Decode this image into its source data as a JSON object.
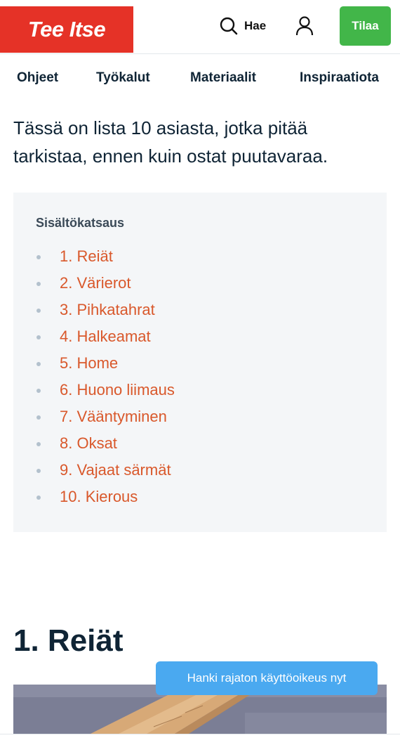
{
  "header": {
    "logo_text": "Tee Itse",
    "search_label": "Hae",
    "subscribe_label": "Tilaa"
  },
  "nav": {
    "items": [
      {
        "label": "Ohjeet"
      },
      {
        "label": "Työkalut"
      },
      {
        "label": "Materiaalit"
      },
      {
        "label": "Inspiraatiota"
      }
    ]
  },
  "article": {
    "intro": "Tässä on lista 10 asiasta, jotka pitää tarkistaa, ennen kuin ostat puutavaraa.",
    "toc": {
      "title": "Sisältökatsaus",
      "items": [
        {
          "label": "1. Reiät"
        },
        {
          "label": "2. Värierot"
        },
        {
          "label": "3. Pihkatahrat"
        },
        {
          "label": "4. Halkeamat"
        },
        {
          "label": "5. Home"
        },
        {
          "label": "6. Huono liimaus"
        },
        {
          "label": "7. Vääntyminen"
        },
        {
          "label": "8. Oksat"
        },
        {
          "label": "9. Vajaat särmät"
        },
        {
          "label": "10. Kierous"
        }
      ]
    },
    "section_heading": "1. Reiät"
  },
  "cta": {
    "label": "Hanki rajaton käyttöoikeus nyt"
  },
  "colors": {
    "brand_red": "#e53227",
    "subscribe_green": "#42b649",
    "link_orange": "#d9582b",
    "cta_blue": "#4aa9f0",
    "text_navy": "#0f2435"
  }
}
